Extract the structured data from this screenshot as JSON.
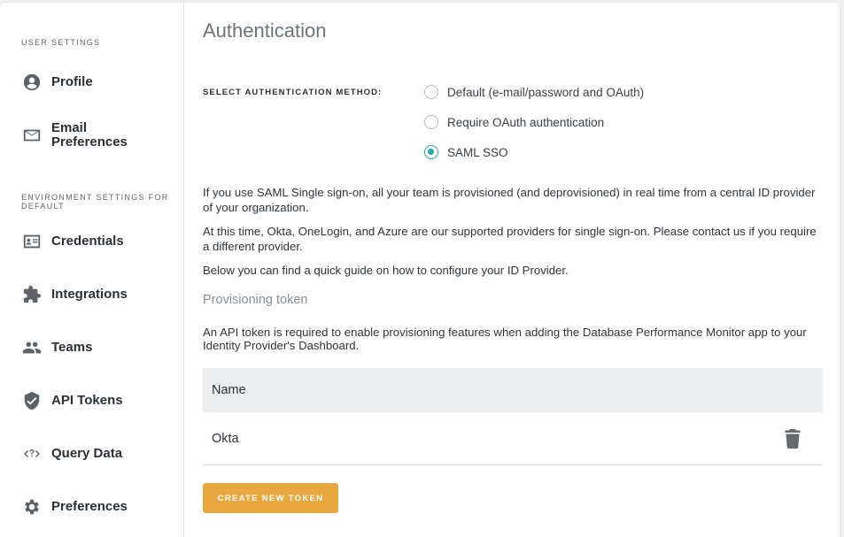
{
  "sidebar": {
    "user_settings_title": "USER SETTINGS",
    "env_settings_title": "ENVIRONMENT SETTINGS FOR DEFAULT",
    "items": [
      {
        "label": "Profile",
        "icon": "person-icon"
      },
      {
        "label": "Email Preferences",
        "icon": "envelope-icon"
      },
      {
        "label": "Credentials",
        "icon": "id-card-icon"
      },
      {
        "label": "Integrations",
        "icon": "puzzle-icon"
      },
      {
        "label": "Teams",
        "icon": "people-icon"
      },
      {
        "label": "API Tokens",
        "icon": "shield-check-icon"
      },
      {
        "label": "Query Data",
        "icon": "code-question-icon"
      },
      {
        "label": "Preferences",
        "icon": "gear-icon"
      }
    ]
  },
  "main": {
    "title": "Authentication",
    "method_label": "SELECT AUTHENTICATION METHOD:",
    "options": [
      {
        "label": "Default (e-mail/password and OAuth)",
        "checked": false
      },
      {
        "label": "Require OAuth authentication",
        "checked": false
      },
      {
        "label": "SAML SSO",
        "checked": true
      }
    ],
    "para1": "If you use SAML Single sign-on, all your team is provisioned (and deprovisioned) in real time from a central ID provider of your organization.",
    "para2": "At this time, Okta, OneLogin, and Azure are our supported providers for single sign-on. Please contact us if you require a different provider.",
    "para3": "Below you can find a quick guide on how to configure your ID Provider.",
    "token_section_title": "Provisioning token",
    "token_description": "An API token is required to enable provisioning features when adding the Database Performance Monitor app to your Identity Provider's Dashboard.",
    "table": {
      "header": "Name",
      "rows": [
        {
          "name": "Okta"
        }
      ]
    },
    "create_button": "CREATE NEW TOKEN"
  },
  "colors": {
    "accent": "#27a9a5",
    "button": "#e9a83f"
  }
}
